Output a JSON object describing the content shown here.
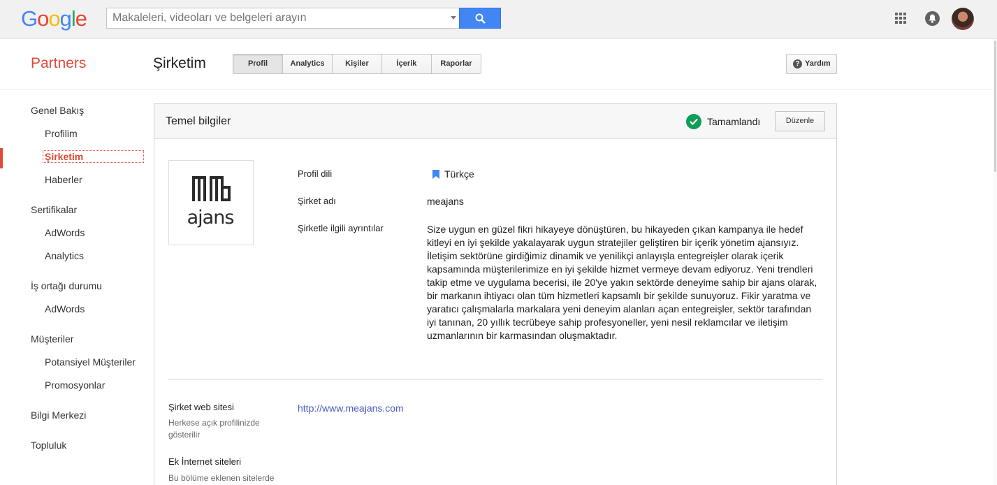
{
  "header": {
    "logo_letters": [
      "G",
      "o",
      "o",
      "g",
      "l",
      "e"
    ],
    "search_placeholder": "Makaleleri, videoları ve belgeleri arayın"
  },
  "subheader": {
    "brand": "Partners",
    "page_title": "Şirketim",
    "tabs": [
      {
        "label": "Profil",
        "active": true
      },
      {
        "label": "Analytics",
        "active": false
      },
      {
        "label": "Kişiler",
        "active": false
      },
      {
        "label": "İçerik",
        "active": false
      },
      {
        "label": "Raporlar",
        "active": false
      }
    ],
    "help_label": "Yardım"
  },
  "sidebar": {
    "items": [
      {
        "label": "Genel Bakış"
      },
      {
        "label": "Profilim"
      },
      {
        "label": "Şirketim"
      },
      {
        "label": "Haberler"
      },
      {
        "label": "Sertifikalar"
      },
      {
        "label": "AdWords"
      },
      {
        "label": "Analytics"
      },
      {
        "label": "İş ortağı durumu"
      },
      {
        "label": "AdWords"
      },
      {
        "label": "Müşteriler"
      },
      {
        "label": "Potansiyel Müşteriler"
      },
      {
        "label": "Promosyonlar"
      },
      {
        "label": "Bilgi Merkezi"
      },
      {
        "label": "Topluluk"
      }
    ]
  },
  "card": {
    "title": "Temel bilgiler",
    "status": "Tamamlandı",
    "edit_label": "Düzenle",
    "company_logo_text": "ajans",
    "fields": {
      "language_label": "Profil dili",
      "language_value": "Türkçe",
      "name_label": "Şirket adı",
      "name_value": "meajans",
      "details_label": "Şirketle ilgili ayrıntılar",
      "details_value": "Size uygun en güzel fikri hikayeye dönüştüren, bu hikayeden çıkan kampanya ile hedef kitleyi en iyi şekilde yakalayarak uygun stratejiler geliştiren bir içerik yönetim ajansıyız. İletişim sektörüne girdiğimiz dinamik ve yenilikçi anlayışla entegreişler olarak içerik kapsamında müşterilerimize en iyi şekilde hizmet vermeye devam ediyoruz. Yeni trendleri takip etme ve uygulama becerisi, ile 20'ye yakın sektörde deneyime sahip bir ajans olarak, bir markanın ihtiyacı olan tüm hizmetleri kapsamlı bir şekilde sunuyoruz. Fikir yaratma ve yaratıcı çalışmalarla markalara yeni deneyim alanları açan entegreişler, sektör tarafından iyi tanınan, 20 yıllık tecrübeye sahip profesyoneller, yeni nesil reklamcılar ve iletişim uzmanlarının bir karmasından oluşmaktadır.",
      "website_label": "Şirket web sitesi",
      "website_hint": "Herkese açık profilinizde gösterilir",
      "website_value": "http://www.meajans.com",
      "extra_label": "Ek İnternet siteleri",
      "extra_hint": "Bu bölüme eklenen sitelerde"
    }
  },
  "colors": {
    "brand_red": "#dd4b39",
    "search_blue": "#4285f4",
    "complete_green": "#0f9d58",
    "link_blue": "#4b5dc4"
  }
}
